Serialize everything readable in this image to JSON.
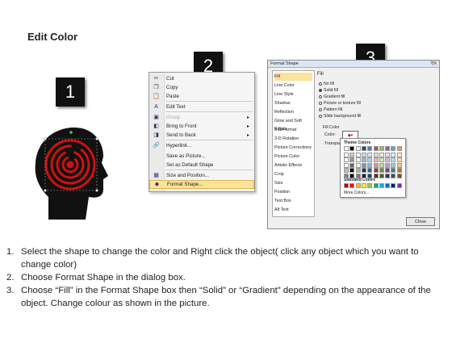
{
  "title": "Edit Color",
  "steps": [
    "1",
    "2",
    "3"
  ],
  "context_menu": {
    "items": [
      {
        "label": "Cut",
        "icon": "scissors-icon",
        "glyph": "✂"
      },
      {
        "label": "Copy",
        "icon": "copy-icon",
        "glyph": "❐"
      },
      {
        "label": "Paste",
        "icon": "paste-icon",
        "glyph": "📋"
      },
      {
        "label": "Edit Text",
        "icon": "edit-text-icon",
        "glyph": "A"
      },
      {
        "label": "Group",
        "icon": "group-icon",
        "glyph": "▣",
        "disabled": true,
        "submenu": true
      },
      {
        "label": "Bring to Front",
        "icon": "bring-front-icon",
        "glyph": "◧",
        "submenu": true
      },
      {
        "label": "Send to Back",
        "icon": "send-back-icon",
        "glyph": "◨",
        "submenu": true
      },
      {
        "label": "Hyperlink...",
        "icon": "hyperlink-icon",
        "glyph": "🔗"
      },
      {
        "label": "Save as Picture...",
        "icon": "save-picture-icon",
        "glyph": ""
      },
      {
        "label": "Set as Default Shape",
        "icon": "",
        "glyph": ""
      },
      {
        "label": "Size and Position...",
        "icon": "size-icon",
        "glyph": "▦"
      },
      {
        "label": "Format Shape...",
        "icon": "format-shape-icon",
        "glyph": "◆",
        "highlighted": true
      }
    ]
  },
  "dialog": {
    "title": "Format Shape",
    "title_buttons": "?|X",
    "nav": [
      "Fill",
      "Line Color",
      "Line Style",
      "Shadow",
      "Reflection",
      "Glow and Soft Edges",
      "3-D Format",
      "3-D Rotation",
      "Picture Corrections",
      "Picture Color",
      "Artistic Effects",
      "Crop",
      "Size",
      "Position",
      "Text Box",
      "Alt Text"
    ],
    "fill_heading": "Fill",
    "options": [
      "No fill",
      "Solid fill",
      "Gradient fill",
      "Picture or texture fill",
      "Pattern fill",
      "Slide background fill"
    ],
    "selected_option": 1,
    "fill_color_label": "Fill Color",
    "color_label": "Color:",
    "transparency_label": "Transpa",
    "close_label": "Close"
  },
  "palette": {
    "theme_heading": "Theme Colors",
    "standard_heading": "Standard Colors",
    "more_label": "More Colors...",
    "theme_top": [
      "#ffffff",
      "#000000",
      "#eeece1",
      "#1f497d",
      "#4f81bd",
      "#c0504d",
      "#9bbb59",
      "#8064a2",
      "#4bacc6",
      "#f79646"
    ],
    "standard": [
      "#c00000",
      "#ff0000",
      "#ffc000",
      "#ffff00",
      "#92d050",
      "#00b050",
      "#00b0f0",
      "#0070c0",
      "#002060",
      "#7030a0"
    ]
  },
  "instructions": [
    {
      "num": "1.",
      "text": "Select the shape to change the color and Right click the object( click any object which you want to change color)"
    },
    {
      "num": "2.",
      "text": "Choose Format Shape in the dialog box."
    },
    {
      "num": "3.",
      "text": "Choose “Fill” in the Format Shape box then “Solid” or “Gradient” depending on the appearance of the object. Change colour as shown in the picture."
    }
  ]
}
